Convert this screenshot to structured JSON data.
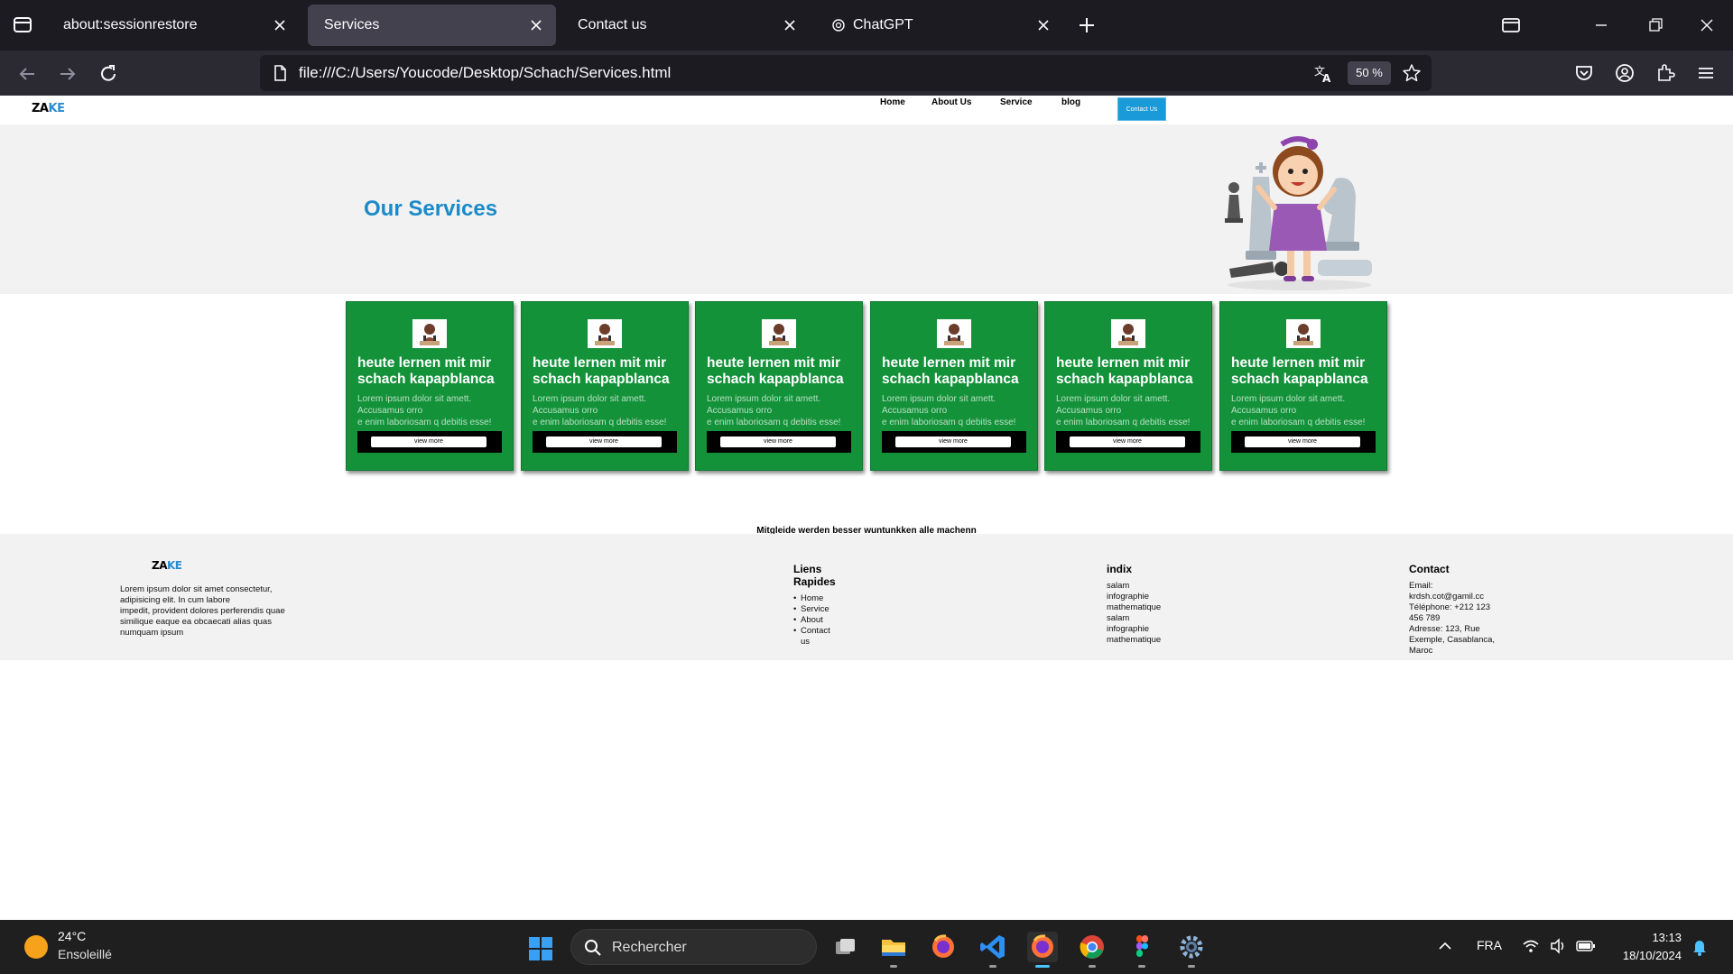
{
  "browser": {
    "tabs": [
      {
        "label": "about:sessionrestore",
        "active": false
      },
      {
        "label": "Services",
        "active": true
      },
      {
        "label": "Contact us",
        "active": false
      },
      {
        "label": "ChatGPT",
        "active": false
      }
    ],
    "url": "file:///C:/Users/Youcode/Desktop/Schach/Services.html",
    "zoom": "50 %"
  },
  "site": {
    "logo_a": "ZA",
    "logo_b": "KE",
    "menu": [
      "Home",
      "About Us",
      "Service",
      "blog"
    ],
    "contact_button": "Contact Us",
    "hero_title": "Our Services",
    "cards": [
      {
        "title": "heute lernen mit mir schach kapapblanca",
        "text1": "Lorem ipsum dolor sit amett.",
        "text2": "Accusamus orro",
        "text3": "e enim laboriosam q debitis esse!",
        "button": "view more"
      },
      {
        "title": "heute lernen mit mir schach kapapblanca",
        "text1": "Lorem ipsum dolor sit amett.",
        "text2": "Accusamus orro",
        "text3": "e enim laboriosam q debitis esse!",
        "button": "view more"
      },
      {
        "title": "heute lernen mit mir schach kapapblanca",
        "text1": "Lorem ipsum dolor sit amett.",
        "text2": "Accusamus orro",
        "text3": "e enim laboriosam q debitis esse!",
        "button": "view more"
      },
      {
        "title": "heute lernen mit mir schach kapapblanca",
        "text1": "Lorem ipsum dolor sit amett.",
        "text2": "Accusamus orro",
        "text3": "e enim laboriosam q debitis esse!",
        "button": "view more"
      },
      {
        "title": "heute lernen mit mir schach kapapblanca",
        "text1": "Lorem ipsum dolor sit amett.",
        "text2": "Accusamus orro",
        "text3": "e enim laboriosam q debitis esse!",
        "button": "view more"
      },
      {
        "title": "heute lernen mit mir schach kapapblanca",
        "text1": "Lorem ipsum dolor sit amett.",
        "text2": "Accusamus orro",
        "text3": "e enim laboriosam q debitis esse!",
        "button": "view more"
      }
    ],
    "tagline": "Mitgleide werden besser wuntunkken alle machenn",
    "footer": {
      "about_lines": [
        "Lorem ipsum dolor sit amet consectetur,",
        "adipisicing elit. In cum labore",
        "impedit, provident dolores perferendis quae",
        "similique eaque ea obcaecati alias quas",
        "numquam ipsum"
      ],
      "links_title_1": "Liens",
      "links_title_2": "Rapides",
      "links": [
        "Home",
        "Service",
        "About",
        "Contact",
        "us"
      ],
      "indix_title": "indix",
      "indix": [
        "salam",
        "infographie",
        "mathematique",
        "salam",
        "infographie",
        "mathematique"
      ],
      "contact_title": "Contact",
      "contact_lines": [
        "Email:",
        "krdsh.cot@gamil.cc",
        "Téléphone: +212 123",
        "456 789",
        "Adresse: 123, Rue",
        "Exemple, Casablanca,",
        "Maroc"
      ]
    }
  },
  "taskbar": {
    "temp": "24°C",
    "weather": "Ensoleillé",
    "search_placeholder": "Rechercher",
    "lang": "FRA",
    "time": "13:13",
    "date": "18/10/2024"
  }
}
